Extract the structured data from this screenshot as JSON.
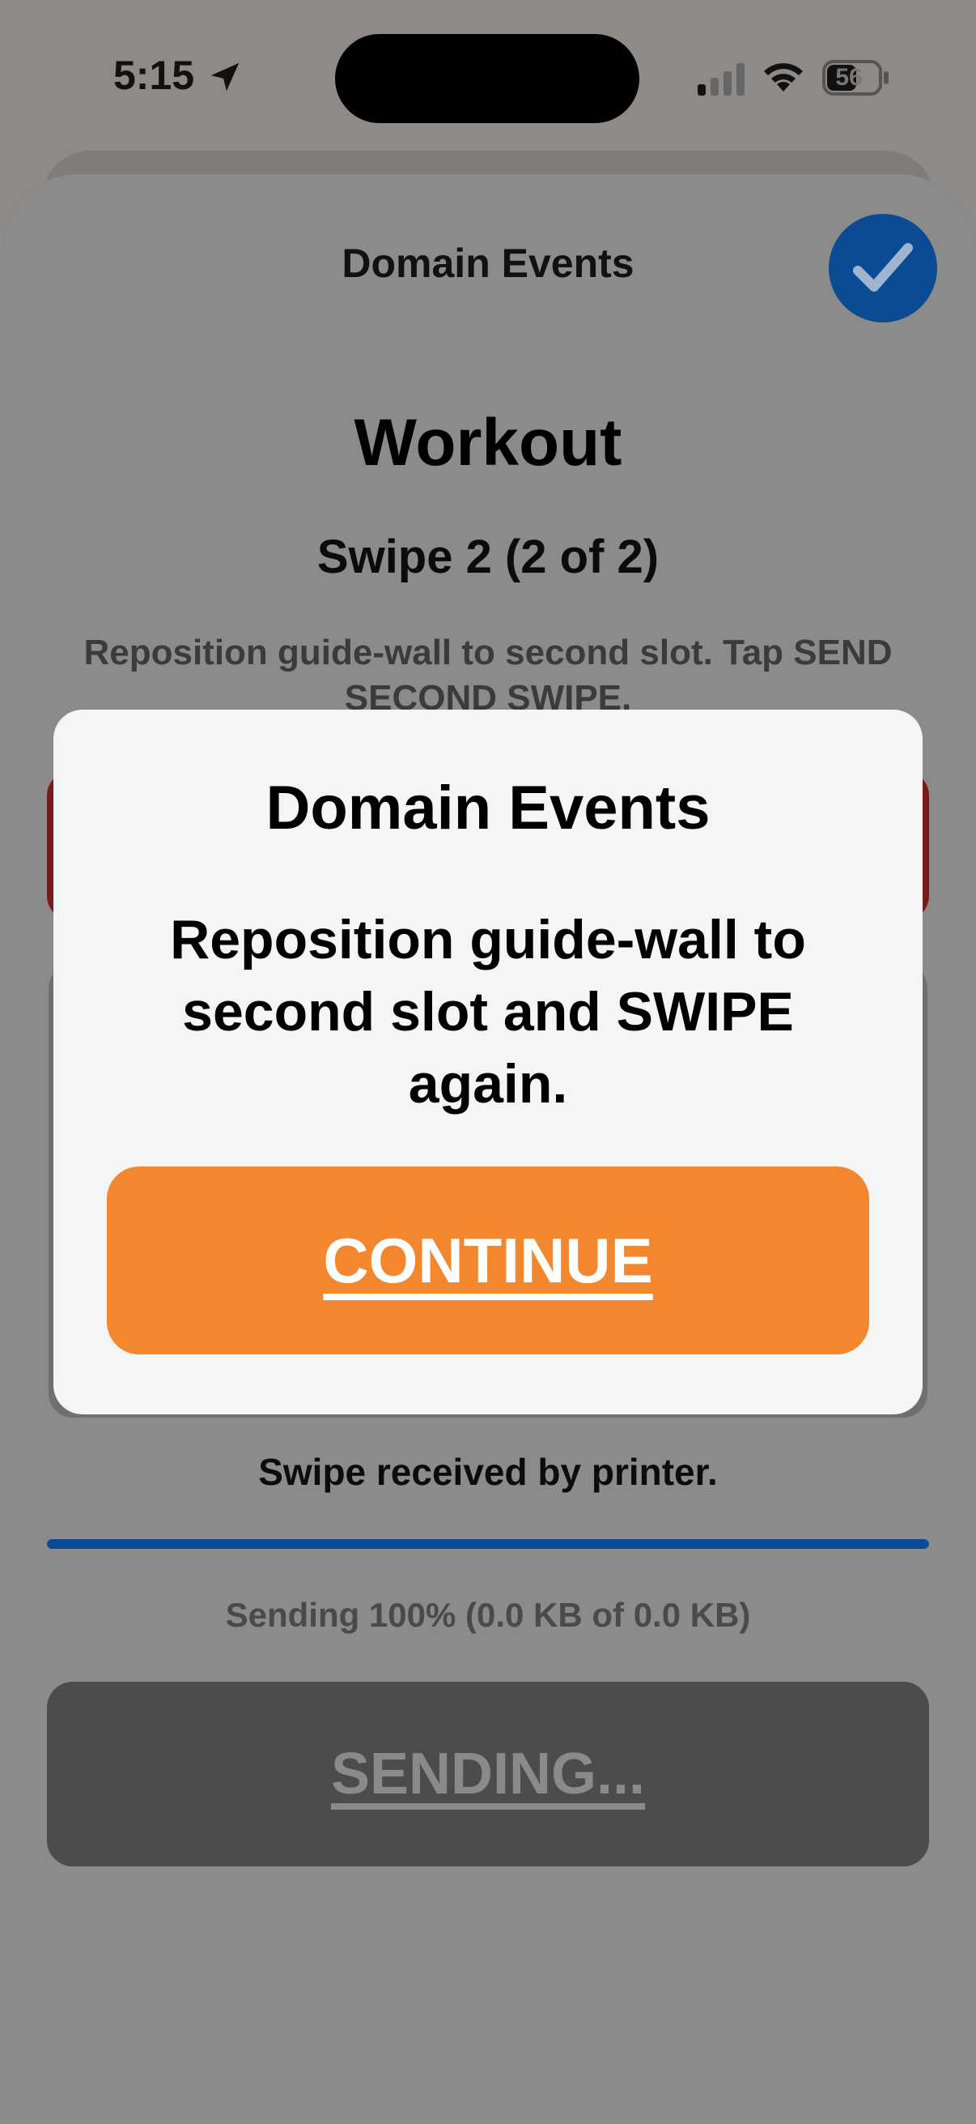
{
  "status_bar": {
    "time": "5:15",
    "battery": "56",
    "icons": [
      "location-arrow-icon",
      "cellular-signal-icon",
      "wifi-icon",
      "battery-icon"
    ]
  },
  "sheet": {
    "title": "Domain Events",
    "done_icon": "checkmark-icon",
    "workout_title": "Workout",
    "step_title": "Swipe 2 (2 of 2)",
    "instruction": "Reposition guide-wall to second slot. Tap SEND SECOND SWIPE.",
    "swipe_status": "Swipe received by printer.",
    "progress": {
      "fraction": 1.0,
      "label": "Sending 100% (0.0 KB of 0.0 KB)"
    },
    "sending_button": "SENDING..."
  },
  "modal": {
    "title": "Domain Events",
    "message": "Reposition guide-wall to second slot and SWIPE again.",
    "continue_button": "CONTINUE"
  },
  "colors": {
    "accent_blue": "#0a4b94",
    "continue_orange": "#f2872f",
    "dim_overlay_sheet": "#8b8b8b",
    "modal_background": "#f4f5f5",
    "alert_red": "#7a1a1a"
  }
}
